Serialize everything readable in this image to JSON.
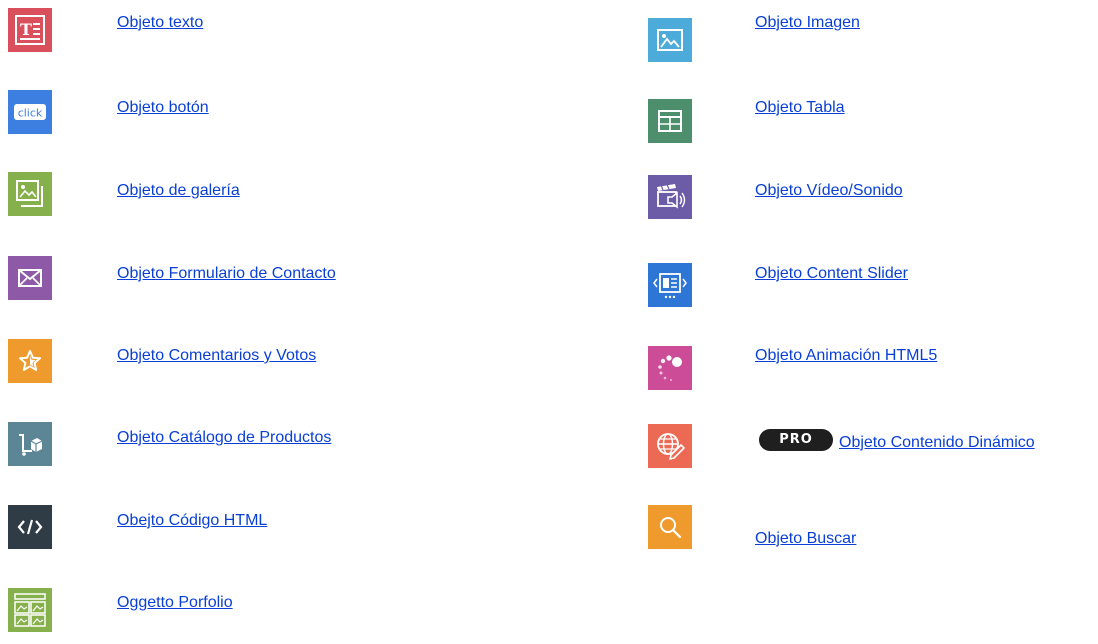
{
  "objects": {
    "left": [
      {
        "label": "Objeto texto",
        "icon": "text-object-icon",
        "color": "#d94f5c"
      },
      {
        "label": "Objeto botón",
        "icon": "button-click-icon",
        "color": "#3d7fe0"
      },
      {
        "label": "Objeto de galería",
        "icon": "gallery-icon",
        "color": "#86b04b"
      },
      {
        "label": "Objeto Formulario de Contacto",
        "icon": "envelope-icon",
        "color": "#8e5aa8"
      },
      {
        "label": "Objeto Comentarios y Votos",
        "icon": "star-icon",
        "color": "#ee9a2c"
      },
      {
        "label": "Objeto Catálogo de Productos",
        "icon": "cart-icon",
        "color": "#5c8696"
      },
      {
        "label": "Obejto Código HTML",
        "icon": "code-icon",
        "color": "#2f3b45"
      },
      {
        "label": "Oggetto Porfolio",
        "icon": "portfolio-grid-icon",
        "color": "#86b04b"
      }
    ],
    "right": [
      {
        "label": "Objeto Imagen",
        "icon": "image-icon",
        "color": "#4dabd9"
      },
      {
        "label": "Objeto Tabla",
        "icon": "table-icon",
        "color": "#4d8f6c"
      },
      {
        "label": "Objeto Vídeo/Sonido",
        "icon": "video-sound-icon",
        "color": "#6c5ca8"
      },
      {
        "label": "Objeto Content Slider",
        "icon": "content-slider-icon",
        "color": "#2e76d6"
      },
      {
        "label": "Objeto Animación HTML5",
        "icon": "animation-dots-icon",
        "color": "#cc4c98"
      },
      {
        "label": "Objeto Contenido Dinámico",
        "icon": "globe-edit-icon",
        "color": "#ec6a54",
        "badge": "PRO"
      },
      {
        "label": "Objeto Buscar",
        "icon": "search-icon",
        "color": "#ee9a2c"
      }
    ]
  },
  "colors": {
    "link": "#0a3fd6",
    "badge_bg": "#1f1f1f"
  }
}
